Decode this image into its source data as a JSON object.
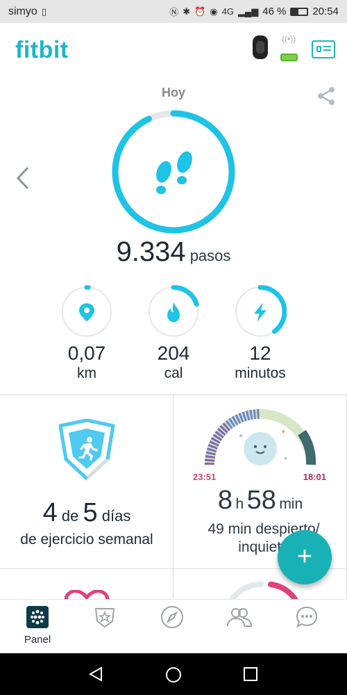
{
  "status_bar": {
    "carrier": "simyo",
    "icons": [
      "sim-icon",
      "nfc-icon",
      "bluetooth-icon",
      "alarm-icon",
      "eye-icon",
      "4g-signal-icon",
      "signal-icon"
    ],
    "network": "4G",
    "battery_percent": "46 %",
    "time": "20:54"
  },
  "header": {
    "logo": "fitbit",
    "device_icon": "tracker-icon",
    "battery_level": 0.8,
    "profile_icon": "profile-card-icon"
  },
  "day": {
    "label": "Hoy",
    "share_icon": "share-icon",
    "prev_icon": "chevron-left-icon"
  },
  "steps": {
    "value": "9.334",
    "unit": "pasos",
    "progress": 0.93
  },
  "stats": [
    {
      "name": "distance",
      "icon": "location-icon",
      "value": "0,07",
      "unit": "km",
      "progress": 0.01
    },
    {
      "name": "calories",
      "icon": "flame-icon",
      "value": "204",
      "unit": "cal",
      "progress": 0.2
    },
    {
      "name": "active",
      "icon": "bolt-icon",
      "value": "12",
      "unit": "minutos",
      "progress": 0.4
    }
  ],
  "exercise": {
    "count": "4",
    "of": "de",
    "goal": "5",
    "unit": "días",
    "subtitle": "de ejercicio semanal",
    "progress": 0.8
  },
  "sleep": {
    "start": "23:51",
    "end": "18:01",
    "hours": "8",
    "h_label": "h",
    "minutes": "58",
    "min_label": "min",
    "subtitle": "49 min despierto/ inquieto"
  },
  "fab_label": "+",
  "nav": [
    {
      "label": "Panel",
      "icon": "panel-icon"
    },
    {
      "label": "",
      "icon": "challenges-icon"
    },
    {
      "label": "",
      "icon": "discover-icon"
    },
    {
      "label": "",
      "icon": "community-icon"
    },
    {
      "label": "",
      "icon": "chat-icon"
    }
  ],
  "colors": {
    "brand": "#1fb5c1",
    "ring": "#1ec3e6",
    "sleep_start": "#e0507a",
    "sleep_end": "#c0276a",
    "fab": "#17b1b6"
  }
}
